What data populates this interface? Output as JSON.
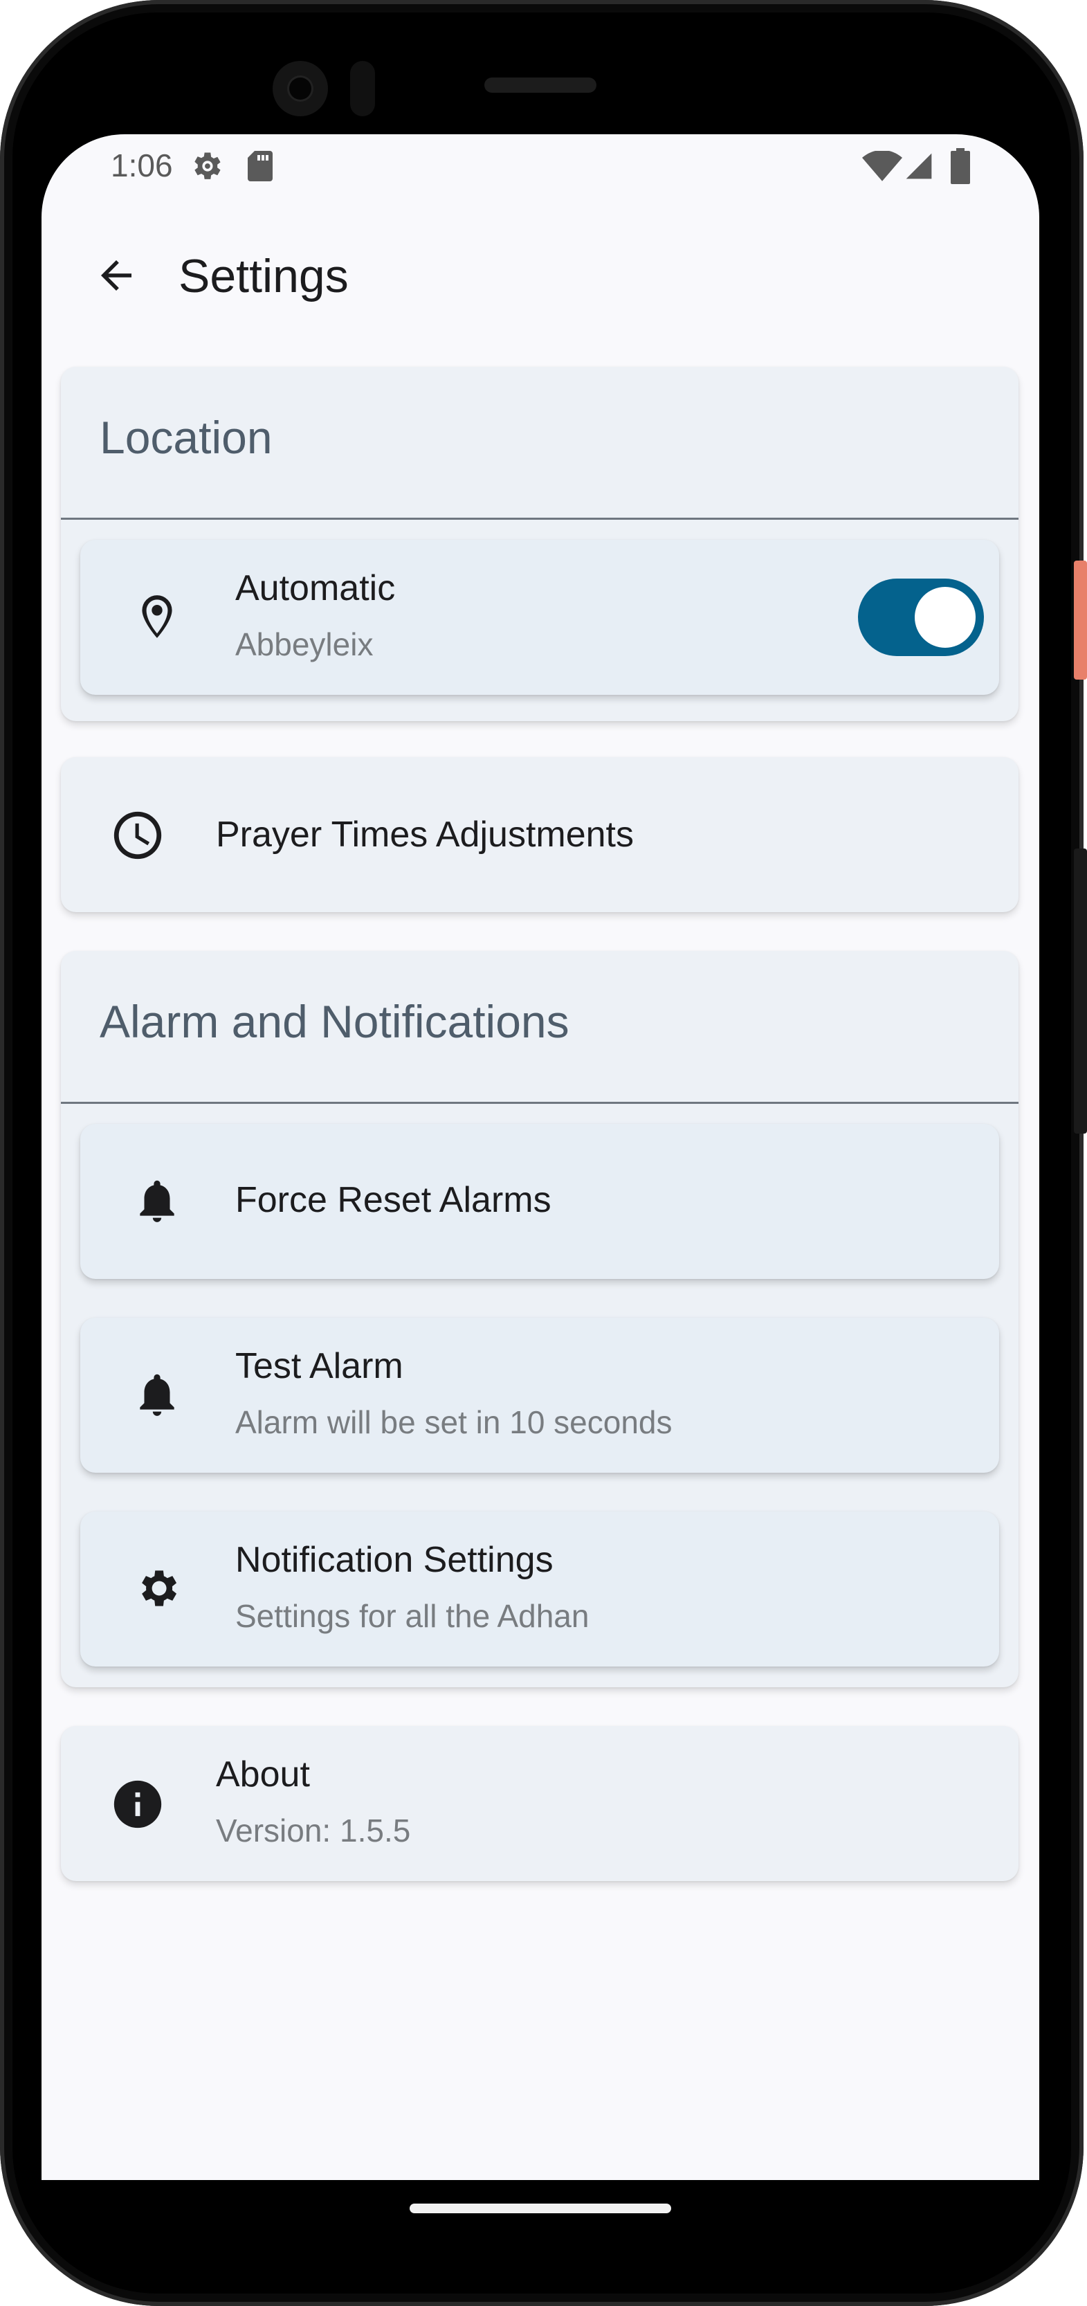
{
  "status_bar": {
    "time": "1:06"
  },
  "app_bar": {
    "title": "Settings"
  },
  "location": {
    "section_title": "Location",
    "automatic": {
      "label": "Automatic",
      "subtitle": "Abbeyleix",
      "enabled": true
    }
  },
  "prayer_times": {
    "label": "Prayer Times Adjustments"
  },
  "alarms": {
    "section_title": "Alarm and Notifications",
    "force_reset": {
      "label": "Force Reset Alarms"
    },
    "test_alarm": {
      "label": "Test Alarm",
      "subtitle": "Alarm will be set in 10 seconds"
    },
    "notification_settings": {
      "label": "Notification Settings",
      "subtitle": "Settings for all the Adhan"
    }
  },
  "about": {
    "label": "About",
    "subtitle": "Version: 1.5.5"
  },
  "icons": {
    "back": "arrow-back-icon",
    "location": "location-pin-icon",
    "clock": "clock-icon",
    "bell": "bell-icon",
    "gear": "gear-icon",
    "info": "info-icon"
  },
  "colors": {
    "toggle_on": "#04628d",
    "section_title": "#4f5d6b",
    "card": "#edf1f6"
  }
}
